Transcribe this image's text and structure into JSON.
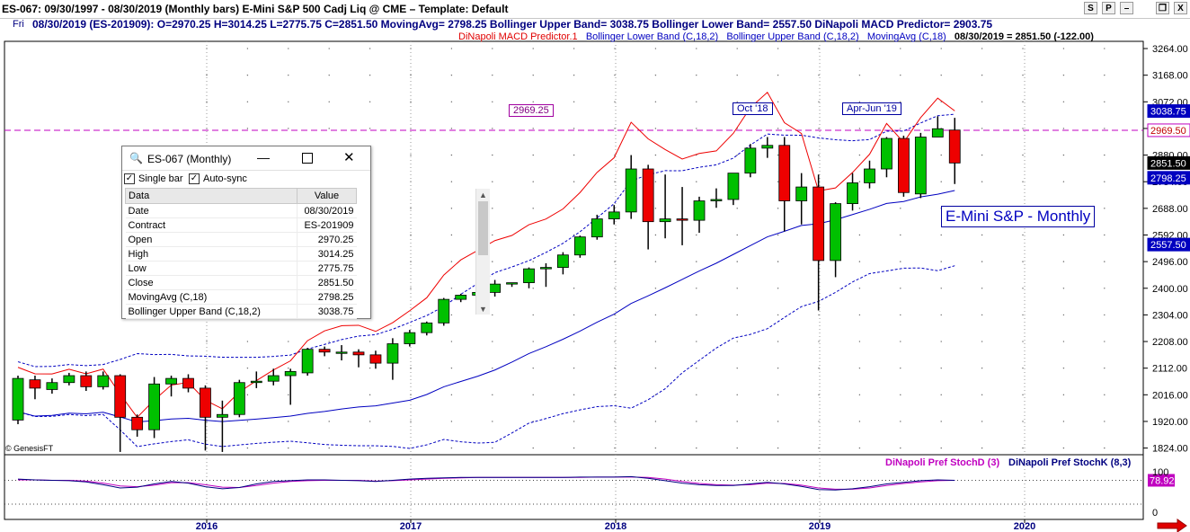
{
  "window": {
    "title": "ES-067:  09/30/1997 - 08/30/2019  (Monthly bars)   E-Mini S&P 500 Cadj Liq @ CME  –  Template: Default",
    "buttons": [
      "S",
      "P",
      "–",
      "❐",
      "X"
    ]
  },
  "info_line": {
    "day": "Fri",
    "values": "08/30/2019 (ES-201909):  O=2970.25  H=3014.25  L=2775.75  C=2851.50  MovingAvg= 2798.25  Bollinger Upper Band= 3038.75  Bollinger Lower Band= 2557.50  DiNapoli MACD Predictor= 2903.75"
  },
  "legend": {
    "macd": "DiNapoli MACD Predictor.1",
    "lower": "Bollinger Lower Band (C,18,2)",
    "upper": "Bollinger Upper Band (C,18,2)",
    "ma": "MovingAvg (C,18)",
    "last": "08/30/2019 = 2851.50 (-122.00)"
  },
  "colors": {
    "up": "#00c000",
    "down": "#ee0000",
    "ma": "#0000c0",
    "band": "#0000c0",
    "macd": "#ee0000",
    "hline": "#c000c0",
    "stochD": "#c000c0",
    "stochK": "#000080"
  },
  "annotations": {
    "level_label": "2969.25",
    "oct18": "Oct '18",
    "aprjun19": "Apr-Jun '19",
    "chart_label": "E-Mini S&P - Monthly",
    "copyright": "© GenesisFT"
  },
  "price_tags": {
    "upper": "3038.75",
    "level": "2969.50",
    "close": "2851.50",
    "ma": "2798.25",
    "lower": "2557.50",
    "stoch": "78.92"
  },
  "sub_legend": {
    "stochD": "DiNapoli Pref StochD (3)",
    "stochK": "DiNapoli Pref StochK (8,3)"
  },
  "sub_axis": [
    "100",
    "0"
  ],
  "data_window": {
    "title": "ES-067 (Monthly)",
    "single_bar": "Single bar",
    "auto_sync": "Auto-sync",
    "col_data": "Data",
    "col_value": "Value",
    "rows": [
      {
        "k": "Date",
        "v": "08/30/2019"
      },
      {
        "k": "Contract",
        "v": "ES-201909"
      },
      {
        "k": "Open",
        "v": "2970.25"
      },
      {
        "k": "High",
        "v": "3014.25"
      },
      {
        "k": "Low",
        "v": "2775.75"
      },
      {
        "k": "Close",
        "v": "2851.50"
      },
      {
        "k": "MovingAvg (C,18)",
        "v": "2798.25"
      },
      {
        "k": "Bollinger Upper Band (C,18,2)",
        "v": "3038.75"
      }
    ]
  },
  "chart_data": {
    "type": "candlestick",
    "y_ticks": [
      "3264.00",
      "3168.00",
      "3072.00",
      "2976.00",
      "2880.00",
      "2784.00",
      "2688.00",
      "2592.00",
      "2496.00",
      "2400.00",
      "2304.00",
      "2208.00",
      "2112.00",
      "2016.00",
      "1920.00",
      "1824.00"
    ],
    "x_ticks": [
      "2016",
      "2017",
      "2018",
      "2019",
      "2020"
    ],
    "horizontal_line": 2969.25,
    "candles": [
      {
        "o": 1925,
        "h": 2085,
        "l": 1910,
        "c": 2075
      },
      {
        "o": 2070,
        "h": 2085,
        "l": 2000,
        "c": 2040
      },
      {
        "o": 2035,
        "h": 2075,
        "l": 2020,
        "c": 2060
      },
      {
        "o": 2060,
        "h": 2095,
        "l": 2050,
        "c": 2085
      },
      {
        "o": 2085,
        "h": 2100,
        "l": 2030,
        "c": 2045
      },
      {
        "o": 2045,
        "h": 2100,
        "l": 2035,
        "c": 2085
      },
      {
        "o": 2085,
        "h": 2090,
        "l": 1810,
        "c": 1935
      },
      {
        "o": 1935,
        "h": 1945,
        "l": 1865,
        "c": 1890
      },
      {
        "o": 1890,
        "h": 2080,
        "l": 1860,
        "c": 2055
      },
      {
        "o": 2055,
        "h": 2085,
        "l": 2010,
        "c": 2075
      },
      {
        "o": 2075,
        "h": 2090,
        "l": 2025,
        "c": 2040
      },
      {
        "o": 2040,
        "h": 2050,
        "l": 1815,
        "c": 1935
      },
      {
        "o": 1935,
        "h": 1995,
        "l": 1810,
        "c": 1945
      },
      {
        "o": 1945,
        "h": 2070,
        "l": 1935,
        "c": 2060
      },
      {
        "o": 2060,
        "h": 2100,
        "l": 2040,
        "c": 2065
      },
      {
        "o": 2065,
        "h": 2110,
        "l": 2050,
        "c": 2085
      },
      {
        "o": 2085,
        "h": 2110,
        "l": 1980,
        "c": 2100
      },
      {
        "o": 2095,
        "h": 2185,
        "l": 2085,
        "c": 2180
      },
      {
        "o": 2180,
        "h": 2190,
        "l": 2155,
        "c": 2170
      },
      {
        "o": 2170,
        "h": 2195,
        "l": 2140,
        "c": 2170
      },
      {
        "o": 2170,
        "h": 2180,
        "l": 2115,
        "c": 2160
      },
      {
        "o": 2160,
        "h": 2175,
        "l": 2110,
        "c": 2130
      },
      {
        "o": 2130,
        "h": 2220,
        "l": 2070,
        "c": 2200
      },
      {
        "o": 2200,
        "h": 2250,
        "l": 2190,
        "c": 2240
      },
      {
        "o": 2240,
        "h": 2280,
        "l": 2230,
        "c": 2275
      },
      {
        "o": 2275,
        "h": 2365,
        "l": 2265,
        "c": 2360
      },
      {
        "o": 2360,
        "h": 2380,
        "l": 2350,
        "c": 2375
      },
      {
        "o": 2375,
        "h": 2400,
        "l": 2330,
        "c": 2385
      },
      {
        "o": 2385,
        "h": 2430,
        "l": 2370,
        "c": 2415
      },
      {
        "o": 2415,
        "h": 2420,
        "l": 2405,
        "c": 2420
      },
      {
        "o": 2420,
        "h": 2475,
        "l": 2400,
        "c": 2470
      },
      {
        "o": 2470,
        "h": 2490,
        "l": 2405,
        "c": 2475
      },
      {
        "o": 2475,
        "h": 2530,
        "l": 2450,
        "c": 2520
      },
      {
        "o": 2520,
        "h": 2590,
        "l": 2510,
        "c": 2585
      },
      {
        "o": 2585,
        "h": 2665,
        "l": 2575,
        "c": 2650
      },
      {
        "o": 2650,
        "h": 2700,
        "l": 2630,
        "c": 2675
      },
      {
        "o": 2675,
        "h": 2880,
        "l": 2650,
        "c": 2830
      },
      {
        "o": 2830,
        "h": 2845,
        "l": 2540,
        "c": 2640
      },
      {
        "o": 2640,
        "h": 2810,
        "l": 2580,
        "c": 2650
      },
      {
        "o": 2650,
        "h": 2765,
        "l": 2555,
        "c": 2645
      },
      {
        "o": 2645,
        "h": 2730,
        "l": 2600,
        "c": 2715
      },
      {
        "o": 2715,
        "h": 2760,
        "l": 2690,
        "c": 2720
      },
      {
        "o": 2720,
        "h": 2805,
        "l": 2700,
        "c": 2815
      },
      {
        "o": 2815,
        "h": 2920,
        "l": 2800,
        "c": 2905
      },
      {
        "o": 2905,
        "h": 2945,
        "l": 2870,
        "c": 2915
      },
      {
        "o": 2915,
        "h": 2945,
        "l": 2605,
        "c": 2715
      },
      {
        "o": 2715,
        "h": 2815,
        "l": 2630,
        "c": 2765
      },
      {
        "o": 2765,
        "h": 2810,
        "l": 2320,
        "c": 2500
      },
      {
        "o": 2500,
        "h": 2710,
        "l": 2440,
        "c": 2705
      },
      {
        "o": 2705,
        "h": 2815,
        "l": 2680,
        "c": 2780
      },
      {
        "o": 2780,
        "h": 2860,
        "l": 2760,
        "c": 2830
      },
      {
        "o": 2830,
        "h": 2945,
        "l": 2800,
        "c": 2940
      },
      {
        "o": 2940,
        "h": 2950,
        "l": 2730,
        "c": 2745
      },
      {
        "o": 2740,
        "h": 2960,
        "l": 2725,
        "c": 2945
      },
      {
        "o": 2945,
        "h": 3020,
        "l": 2960,
        "c": 2975
      },
      {
        "o": 2970.25,
        "h": 3014.25,
        "l": 2775.75,
        "c": 2851.5
      }
    ]
  }
}
